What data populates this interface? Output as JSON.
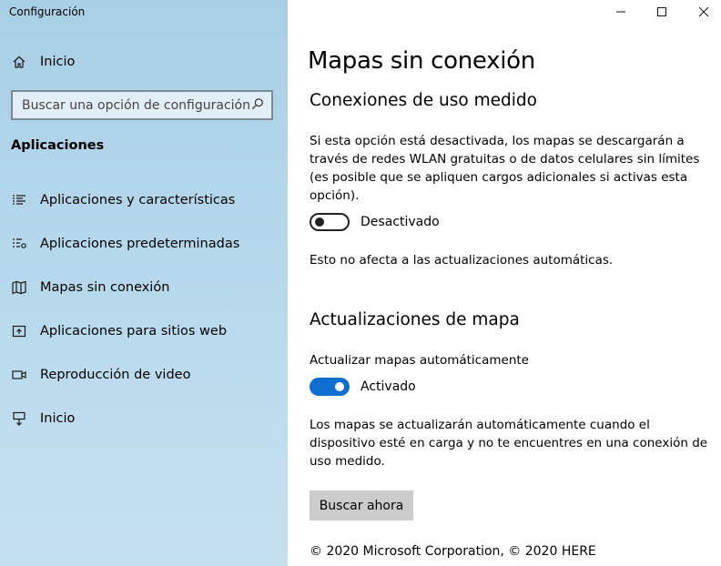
{
  "window": {
    "title": "Configuración"
  },
  "sidebar": {
    "home_label": "Inicio",
    "search": {
      "placeholder": "Buscar una opción de configuración"
    },
    "section_title": "Aplicaciones",
    "items": [
      {
        "label": "Aplicaciones y características",
        "icon": "list-icon"
      },
      {
        "label": "Aplicaciones predeterminadas",
        "icon": "default-apps-icon"
      },
      {
        "label": "Mapas sin conexión",
        "icon": "map-icon"
      },
      {
        "label": "Aplicaciones para sitios web",
        "icon": "open-in-new-window-icon"
      },
      {
        "label": "Reproducción de video",
        "icon": "video-icon"
      },
      {
        "label": "Inicio",
        "icon": "startup-icon"
      }
    ]
  },
  "main": {
    "title": "Mapas sin conexión",
    "metered": {
      "heading": "Conexiones de uso medido",
      "description": "Si esta opción está desactivada, los mapas se descargarán a través de redes WLAN gratuitas o de datos celulares sin límites (es posible que se apliquen cargos adicionales si activas esta opción).",
      "toggle_state": "Desactivado",
      "toggle_on": false,
      "note": "Esto no afecta a las actualizaciones automáticas."
    },
    "updates": {
      "heading": "Actualizaciones de mapa",
      "auto_label": "Actualizar mapas automáticamente",
      "toggle_state": "Activado",
      "toggle_on": true,
      "description": "Los mapas se actualizarán automáticamente cuando el dispositivo esté en carga y no te encuentres en una conexión de uso medido.",
      "button_label": "Buscar ahora"
    },
    "copyright": "© 2020 Microsoft Corporation, © 2020 HERE"
  },
  "colors": {
    "accent": "#0f6fd0",
    "sidebar_bg": "#b3d6ea",
    "button_bg": "#cccccc"
  }
}
